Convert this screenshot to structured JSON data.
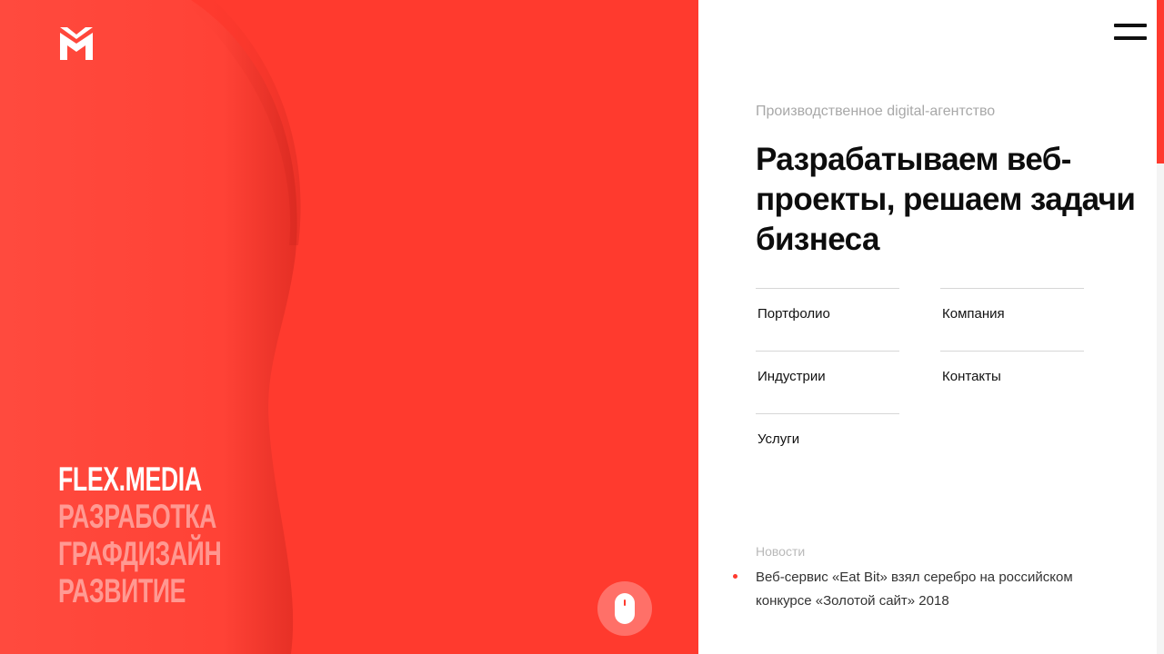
{
  "colors": {
    "accent": "#ff3a2e",
    "text": "#0d0d0d",
    "muted": "#a8a8a8",
    "divider": "#d6d6d6"
  },
  "hero": {
    "logo_icon": "flex-media-logo",
    "tagline": {
      "brand": "FLEX.MEDIA",
      "lines": [
        "РАЗРАБОТКА",
        "ГРАФДИЗАЙН",
        "РАЗВИТИЕ"
      ]
    },
    "scroll_icon": "mouse-icon"
  },
  "panel": {
    "menu_icon": "hamburger-menu-icon",
    "subtitle": "Производственное digital-агентство",
    "headline": "Разрабатываем веб-проекты, решаем задачи бизнеса",
    "nav": [
      {
        "label": "Портфолио"
      },
      {
        "label": "Компания"
      },
      {
        "label": "Индустрии"
      },
      {
        "label": "Контакты"
      },
      {
        "label": "Услуги"
      }
    ],
    "news": {
      "title": "Новости",
      "item": "Веб-сервис «Eat Bit» взял серебро на российском конкурсе «Золотой сайт» 2018"
    }
  }
}
